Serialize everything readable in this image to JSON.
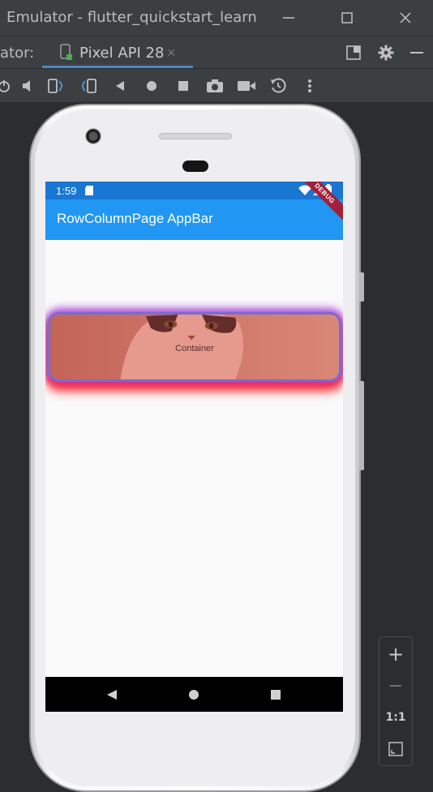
{
  "window": {
    "title": "Emulator - flutter_quickstart_learn",
    "minimize_icon": "minimize-icon",
    "maximize_icon": "maximize-icon",
    "close_icon": "close-icon"
  },
  "tabbar": {
    "label": "ator:",
    "tabs": [
      {
        "label": "Pixel API 28",
        "icon": "device-icon",
        "close": "×"
      }
    ],
    "actions": [
      "window-mode-icon",
      "gear-icon",
      "hide-icon"
    ]
  },
  "toolbar": {
    "icons": [
      "power-icon",
      "volume-icon",
      "rotate-left-icon",
      "rotate-right-icon",
      "back-icon",
      "home-icon",
      "overview-icon",
      "camera-icon",
      "video-icon",
      "snapshot-icon",
      "more-icon"
    ]
  },
  "device": {
    "statusbar": {
      "time": "1:59"
    },
    "appbar": {
      "title": "RowColumnPage AppBar"
    },
    "debug_banner": "DEBUG",
    "container": {
      "text": "Container"
    },
    "navbar": {
      "icons": [
        "back-triangle-icon",
        "home-circle-icon",
        "recents-square-icon"
      ]
    }
  },
  "zoom_panel": {
    "zoom_in": "+",
    "zoom_out": "−",
    "actual_size": "1:1",
    "fit_icon": "fit-screen-icon"
  },
  "colors": {
    "ide_bg": "#2b2d30",
    "ide_panel": "#3c3f41",
    "statusbar": "#1976d2",
    "appbar": "#2196f3",
    "accent": "#4a88c7"
  }
}
